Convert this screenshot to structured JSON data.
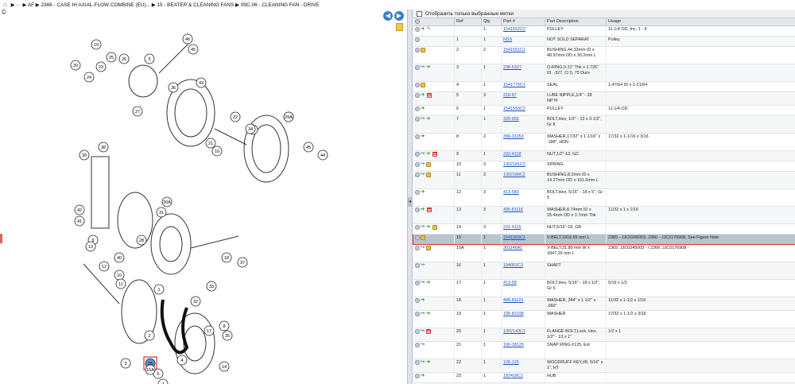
{
  "breadcrumb": {
    "home_icon": "home-icon",
    "segments": [
      "AF",
      "2366 - CASE IH AXIAL-FLOW COMBINE (EU)...",
      "15 - BEATER & CLEANING FANS",
      "09C-06 - CLEANING FAN - DRIVE"
    ]
  },
  "diagram": {
    "callouts": [
      "19",
      "20",
      "25",
      "26",
      "24",
      "5",
      "46",
      "45",
      "23",
      "43",
      "27",
      "36",
      "22",
      "29",
      "30",
      "21",
      "34",
      "16",
      "45",
      "44",
      "38",
      "39",
      "42",
      "41",
      "30A",
      "31",
      "28",
      "9",
      "13",
      "12",
      "10",
      "11",
      "1",
      "40",
      "32",
      "33",
      "37",
      "2",
      "3",
      "6",
      "4",
      "15",
      "15A",
      "7",
      "14",
      "17",
      "8",
      "35",
      "18",
      "29A"
    ],
    "selected_callout": "15"
  },
  "filter": {
    "label": "Отобразить только выбранные метки"
  },
  "columns": {
    "ref": "Ref",
    "qty": "Qty",
    "part": "Part #",
    "desc": "Part Description",
    "usage": "Usage"
  },
  "rows": [
    {
      "ref": "",
      "qty": "1",
      "part": "1541552C2",
      "desc": "PULLEY",
      "usage": "11-1/4 OD, Inc. 1 - 4",
      "icons": [
        "info",
        "arrow",
        "wrench"
      ]
    },
    {
      "ref": "1",
      "qty": "1",
      "part": "NSS",
      "desc": "NOT SOLD SEPARAT",
      "usage": "Pulley",
      "icons": [
        "info"
      ]
    },
    {
      "ref": "2",
      "qty": "2",
      "part": "1541551C1",
      "desc": "BUSHING,44.32mm ID x 48.97mm OD x 30.2mm L",
      "usage": "",
      "icons": [
        "info",
        "box"
      ]
    },
    {
      "ref": "3",
      "qty": "1",
      "part": "238-5327",
      "desc": "O-RING,0.21\" Thk x 1.725\" ID, -327, Cl 5, 75 Duro",
      "usage": "",
      "icons": [
        "info",
        "undo",
        "arrow"
      ]
    },
    {
      "ref": "4",
      "qty": "1",
      "part": "1541775C1",
      "desc": "SEAL",
      "usage": "1-47/64 ID x 2-21/64",
      "icons": [
        "info",
        "box"
      ]
    },
    {
      "ref": "5",
      "qty": "3",
      "part": "219-67",
      "desc": "LUBE NIPPLE,1/4\" - 28 NPTF",
      "usage": "",
      "icons": [
        "info",
        "arrow",
        "list"
      ]
    },
    {
      "ref": "6",
      "qty": "1",
      "part": "1541553C2",
      "desc": "PULLEY",
      "usage": "11-1/4 OD",
      "icons": [
        "info",
        "arrow"
      ]
    },
    {
      "ref": "7",
      "qty": "1",
      "part": "326-656",
      "desc": "BOLT,Hex, 1/2\" - 13 x 3-1/2\", Gr 8",
      "usage": "",
      "icons": [
        "info",
        "undo",
        "arrow"
      ]
    },
    {
      "ref": "8",
      "qty": "2",
      "part": "396-31053",
      "desc": "WASHER,17/32\" x 1 1/16\" x .188\", HDN",
      "usage": "17/32 x 1-1/16 x 3/16",
      "icons": [
        "info",
        "arrow"
      ]
    },
    {
      "ref": "9",
      "qty": "1",
      "part": "232-4118",
      "desc": "NUT,1/2\"-13, GC",
      "usage": "",
      "icons": [
        "info",
        "undo",
        "arrow",
        "list"
      ]
    },
    {
      "ref": "10",
      "qty": "3",
      "part": "1302181C2",
      "desc": "SPRING",
      "usage": "",
      "icons": [
        "info",
        "undo",
        "box"
      ]
    },
    {
      "ref": "11",
      "qty": "3",
      "part": "1302180C2",
      "desc": "BUSHING,8.2mm ID x 14.27mm OD x 101.6mm L",
      "usage": "",
      "icons": [
        "info",
        "undo",
        "box"
      ]
    },
    {
      "ref": "12",
      "qty": "3",
      "part": "413-580",
      "desc": "BOLT,Hex, 5/16\" - 18 x 5\", Gr 5",
      "usage": "",
      "icons": [
        "info",
        "arrow"
      ]
    },
    {
      "ref": "13",
      "qty": "3",
      "part": "495-81116",
      "desc": "WASHER,8.74mm ID x 25.4mm OD x 1.7mm Thk",
      "usage": "11/32 x 1 x 1/16",
      "icons": [
        "info",
        "arrow",
        "list"
      ]
    },
    {
      "ref": "14",
      "qty": "3",
      "part": "231-4115",
      "desc": "NUT,5/16\"-18, GB",
      "usage": "",
      "icons": [
        "info",
        "undo",
        "arrow",
        "box"
      ]
    },
    {
      "ref": "15",
      "qty": "1",
      "part": "1541569C1",
      "desc": "V-BELT,1816.65 mm L",
      "usage": "2365 - JJC0245003, 2366 - JJC0176908, See Figure Note",
      "icons": [
        "info",
        "box"
      ],
      "selected": true
    },
    {
      "ref": "15A",
      "qty": "1",
      "part": "301146A1",
      "desc": "V-BELT,31.80 mm W x 1847.25 mm L",
      "usage": "2365: JJC0245003 - / 2366: JJC0176908 -",
      "icons": [
        "info",
        "undo",
        "box"
      ]
    },
    {
      "ref": "16",
      "qty": "1",
      "part": "194053C3",
      "desc": "SHAFT",
      "usage": "",
      "icons": [
        "info",
        "undo"
      ]
    },
    {
      "ref": "17",
      "qty": "1",
      "part": "413-58",
      "desc": "BOLT,Hex, 5/16\" - 18 x 1/2\", Gr 5",
      "usage": "5/16 x 1/2",
      "icons": [
        "info",
        "undo",
        "arrow"
      ]
    },
    {
      "ref": "18",
      "qty": "1",
      "part": "495-81121",
      "desc": "WASHER, 344\" x 1 1/2\" x .060\"",
      "usage": "11/32 x 1-1/2 x 1/16",
      "icons": [
        "info",
        "arrow"
      ]
    },
    {
      "ref": "19",
      "qty": "1",
      "part": "195-81038",
      "desc": "WASHER",
      "usage": "17/32 x 1-1/2 x 3/16",
      "icons": [
        "info",
        "undo",
        "arrow"
      ]
    },
    {
      "ref": "20",
      "qty": "1",
      "part": "1302143C1",
      "desc": "FLANGE BOLT,Lock, Hex, 1/2\" - 13 x 1\"",
      "usage": "1/2 x 1",
      "icons": [
        "info",
        "undo",
        "list"
      ]
    },
    {
      "ref": "21",
      "qty": "1",
      "part": "190-18125",
      "desc": "SNAP RING,#125, Ext",
      "usage": "",
      "icons": [
        "info",
        "undo"
      ]
    },
    {
      "ref": "22",
      "qty": "1",
      "part": "126-125",
      "desc": "WOODRUFF KEY,#8, 5/16\" x 1\", HT",
      "usage": "",
      "icons": [
        "info",
        "undo",
        "arrow"
      ]
    },
    {
      "ref": "23",
      "qty": "1",
      "part": "192418C1",
      "desc": "HUB",
      "usage": "",
      "icons": [
        "info",
        "arrow"
      ]
    },
    {
      "ref": "24",
      "qty": "2",
      "part": "1302725C91",
      "desc": "BALL BEARING,31.75mm ID",
      "usage": "",
      "icons": [
        "info",
        "arrow"
      ]
    }
  ]
}
